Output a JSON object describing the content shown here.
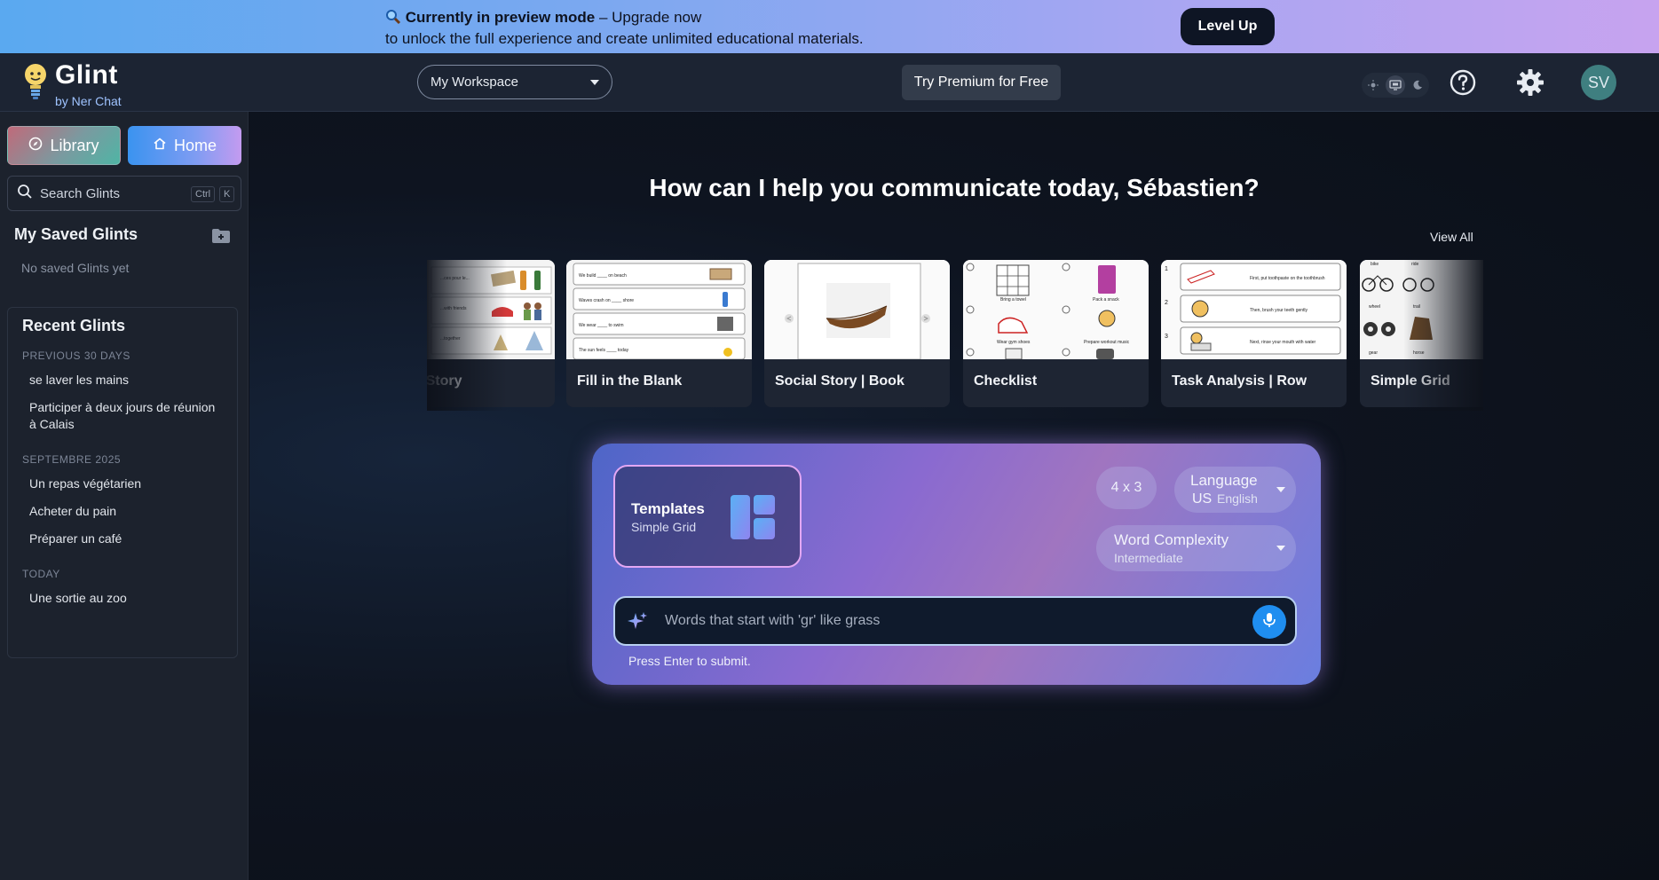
{
  "banner": {
    "icon": "magnifier-icon",
    "strong": "Currently in preview mode",
    "dash": " – Upgrade now",
    "line2": "to unlock the full experience and create unlimited educational materials.",
    "cta": "Level Up"
  },
  "header": {
    "app_name": "Glint",
    "by_line": "by Ner Chat",
    "workspace": "My Workspace",
    "premium_cta": "Try Premium for Free",
    "avatar_initials": "SV"
  },
  "sidebar": {
    "library_label": "Library",
    "home_label": "Home",
    "search_placeholder": "Search Glints",
    "search_kbd_1": "Ctrl",
    "search_kbd_2": "K",
    "saved_title": "My Saved Glints",
    "no_saved": "No saved Glints yet",
    "recent_title": "Recent Glints",
    "groups": [
      {
        "label": "PREVIOUS 30 DAYS",
        "items": [
          "se laver les mains",
          "Participer à deux jours de réunion à Calais"
        ]
      },
      {
        "label": "SEPTEMBRE 2025",
        "items": [
          "Un repas végétarien",
          "Acheter du pain",
          "Préparer un café"
        ]
      },
      {
        "label": "TODAY",
        "items": [
          "Une sortie au zoo"
        ]
      }
    ]
  },
  "main": {
    "headline": "How can I help you communicate today, Sébastien?",
    "view_all": "View All",
    "cards": [
      {
        "label": "Social Story"
      },
      {
        "label": "Fill in the Blank"
      },
      {
        "label": "Social Story | Book"
      },
      {
        "label": "Checklist"
      },
      {
        "label": "Task Analysis | Row"
      },
      {
        "label": "Simple Grid"
      }
    ],
    "thumb_text": {
      "fill_blank": [
        "We build ____ on beach",
        "Waves crash on ____ shore",
        "We wear ____ to swim",
        "The sun feels ____ today"
      ],
      "checklist": [
        "Bring a towel",
        "Pack a snack",
        "Wear gym shoes",
        "Prepare workout music"
      ],
      "task": [
        "First, put toothpaste on the toothbrush",
        "Then, brush your teeth gently",
        "Next, rinse your mouth with water"
      ],
      "grid": [
        "bike",
        "ride",
        "wheel",
        "trail",
        "gear",
        "horse"
      ],
      "story": [
        "...ces pour le...",
        "...with friends",
        "...together"
      ]
    }
  },
  "prompt": {
    "templates_title": "Templates",
    "templates_sub": "Simple Grid",
    "grid_size": "4 x 3",
    "language_label": "Language",
    "language_flag": "US",
    "language_value": "English",
    "complexity_label": "Word Complexity",
    "complexity_value": "Intermediate",
    "input_placeholder": "Words that start with 'gr' like grass",
    "hint": "Press Enter to submit."
  }
}
